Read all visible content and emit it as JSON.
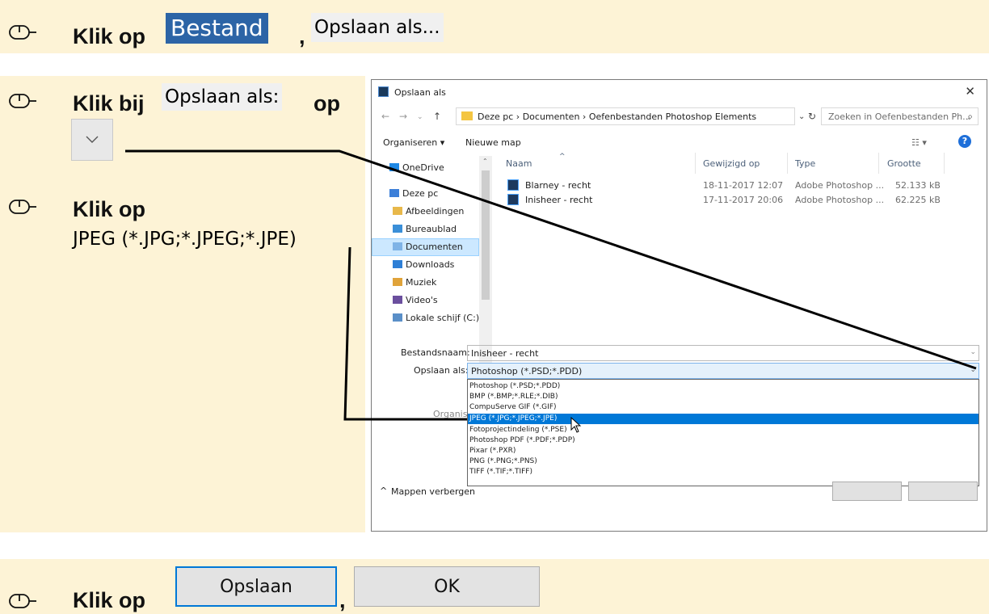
{
  "step1": {
    "prefix": "Klik op",
    "button": "Bestand",
    "sep": ",",
    "menu_item": "Opslaan als..."
  },
  "step2": {
    "prefix": "Klik bij",
    "label": "Opslaan als:",
    "suffix": "op"
  },
  "step3": {
    "prefix": "Klik op",
    "item": "JPEG (*.JPG;*.JPEG;*.JPE)"
  },
  "step4": {
    "prefix": "Klik op",
    "button1": "Opslaan",
    "sep": ",",
    "button2": "OK"
  },
  "dialog": {
    "title": "Opslaan als",
    "breadcrumb": "Deze pc  ›  Documenten  ›  Oefenbestanden Photoshop Elements",
    "search_placeholder": "Zoeken in Oefenbestanden Ph...",
    "toolbar": {
      "organize": "Organiseren ▾",
      "new_folder": "Nieuwe map"
    },
    "sidebar": [
      {
        "label": "OneDrive",
        "color": "#1e88e5"
      },
      {
        "label": "Deze pc",
        "color": "#3c7fd8"
      },
      {
        "label": "Afbeeldingen",
        "color": "#e8b84a"
      },
      {
        "label": "Bureaublad",
        "color": "#3a8fd8"
      },
      {
        "label": "Documenten",
        "color": "#7fb3e6"
      },
      {
        "label": "Downloads",
        "color": "#2e7fd6"
      },
      {
        "label": "Muziek",
        "color": "#e0a33a"
      },
      {
        "label": "Video's",
        "color": "#6b4f9e"
      },
      {
        "label": "Lokale schijf (C:)",
        "color": "#5a8fc8"
      }
    ],
    "columns": {
      "name": "Naam",
      "modified": "Gewijzigd op",
      "type": "Type",
      "size": "Grootte"
    },
    "files": [
      {
        "name": "Blarney - recht",
        "modified": "18-11-2017 12:07",
        "type": "Adobe Photoshop ...",
        "size": "52.133 kB"
      },
      {
        "name": "Inisheer - recht",
        "modified": "17-11-2017 20:06",
        "type": "Adobe Photoshop ...",
        "size": "62.225 kB"
      }
    ],
    "filename_label": "Bestandsnaam:",
    "filename_value": "Inisheer - recht",
    "savetype_label": "Opslaan als:",
    "savetype_value": "Photoshop (*.PSD;*.PDD)",
    "options": [
      "Photoshop (*.PSD;*.PDD)",
      "BMP (*.BMP;*.RLE;*.DIB)",
      "CompuServe GIF (*.GIF)",
      "JPEG (*.JPG;*.JPEG;*.JPE)",
      "Fotoprojectindeling (*.PSE)",
      "Photoshop PDF (*.PDF;*.PDP)",
      "Pixar (*.PXR)",
      "PNG (*.PNG;*.PNS)",
      "TIFF (*.TIF;*.TIFF)"
    ],
    "selected_option_index": 3,
    "organize_partial": "Organise",
    "hide_folders": "Mappen verbergen"
  }
}
